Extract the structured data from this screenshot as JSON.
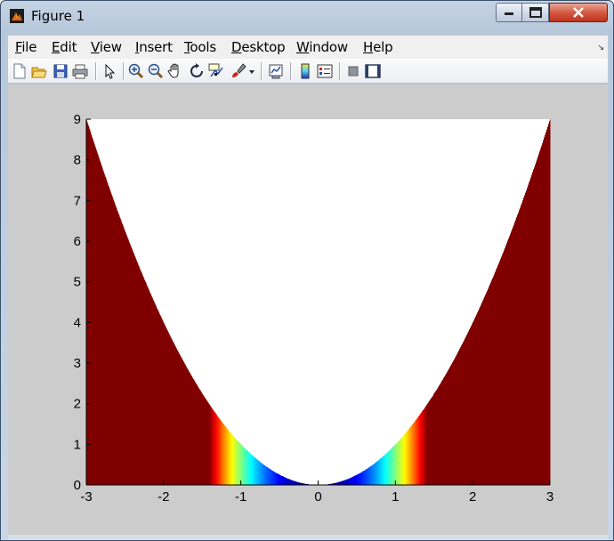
{
  "window": {
    "title": "Figure 1",
    "icon": "matlab-icon"
  },
  "menu": {
    "items": [
      {
        "label_u": "F",
        "label_rest": "ile"
      },
      {
        "label_u": "E",
        "label_rest": "dit"
      },
      {
        "label_u": "V",
        "label_rest": "iew"
      },
      {
        "label_u": "I",
        "label_rest": "nsert"
      },
      {
        "label_u": "T",
        "label_rest": "ools"
      },
      {
        "label_u": "D",
        "label_rest": "esktop"
      },
      {
        "label_u": "W",
        "label_rest": "indow"
      },
      {
        "label_u": "H",
        "label_rest": "elp"
      }
    ],
    "overflow_glyph": "↘"
  },
  "toolbar": {
    "icons": [
      "new-figure-icon",
      "open-file-icon",
      "save-figure-icon",
      "print-figure-icon",
      "edit-plot-icon",
      "zoom-in-icon",
      "zoom-out-icon",
      "pan-icon",
      "rotate-3d-icon",
      "data-cursor-icon",
      "brush-icon",
      "link-plot-icon",
      "insert-colorbar-icon",
      "insert-legend-icon",
      "hide-plot-tools-icon",
      "show-plot-tools-icon"
    ]
  },
  "chart_data": {
    "type": "area",
    "description_curve": "y = x^2",
    "x_range": [
      -3,
      3
    ],
    "ylim": [
      0,
      9
    ],
    "xticks": [
      "-3",
      "-2",
      "-1",
      "0",
      "1",
      "2",
      "3"
    ],
    "yticks": [
      "0",
      "1",
      "2",
      "3",
      "4",
      "5",
      "6",
      "7",
      "8",
      "9"
    ],
    "fill": "region below y = x^2 shaded with jet colormap by height (clipped at ~2), region above curve white",
    "colormap": "jet",
    "colormap_range": [
      0,
      2
    ],
    "above_color": "#ffffff",
    "axes_bg": "#ffffff",
    "figure_bg": "#cccccc"
  }
}
